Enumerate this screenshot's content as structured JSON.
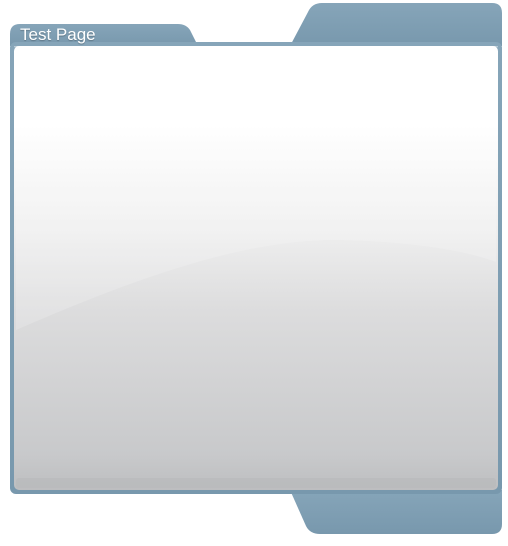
{
  "window": {
    "title": "Test Page"
  },
  "colors": {
    "frame": "#7d9db2",
    "frame_border": "#6b8ca3",
    "panel_top": "#ffffff",
    "panel_mid": "#f0f0f0",
    "panel_bottom": "#c8c9cb",
    "panel_footer": "#b9babc"
  }
}
